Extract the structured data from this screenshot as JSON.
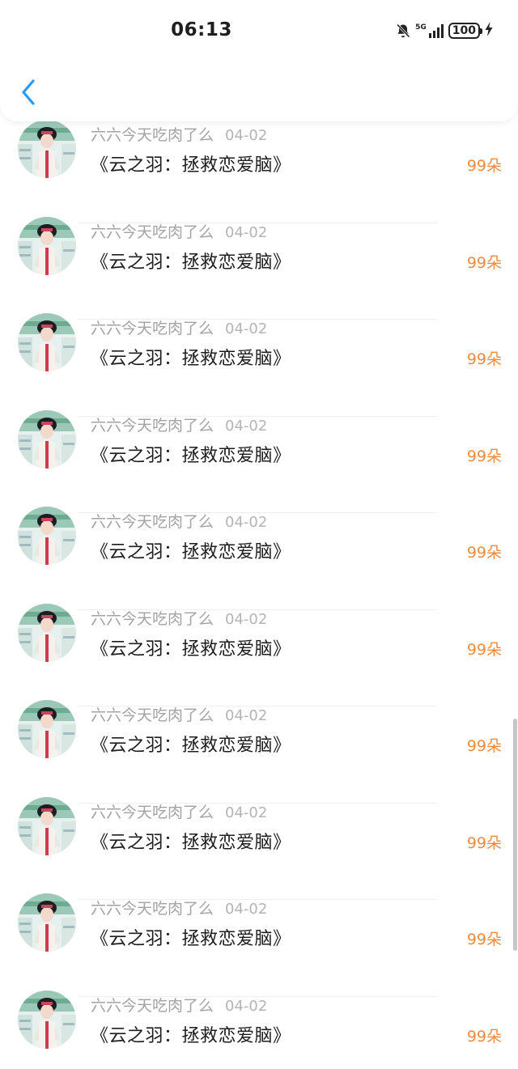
{
  "status_bar": {
    "time": "06:13",
    "network": "5G",
    "battery": "100"
  },
  "header": {
    "back_icon": "chevron-left-icon"
  },
  "colors": {
    "accent": "#2b9af3",
    "count": "#f08a3c",
    "meta": "#a3a3a3"
  },
  "list": {
    "items": [
      {
        "user": "六六今天吃肉了么",
        "date": "04-02",
        "title": "《云之羽：拯救恋爱脑》",
        "count": "99朵"
      },
      {
        "user": "六六今天吃肉了么",
        "date": "04-02",
        "title": "《云之羽：拯救恋爱脑》",
        "count": "99朵"
      },
      {
        "user": "六六今天吃肉了么",
        "date": "04-02",
        "title": "《云之羽：拯救恋爱脑》",
        "count": "99朵"
      },
      {
        "user": "六六今天吃肉了么",
        "date": "04-02",
        "title": "《云之羽：拯救恋爱脑》",
        "count": "99朵"
      },
      {
        "user": "六六今天吃肉了么",
        "date": "04-02",
        "title": "《云之羽：拯救恋爱脑》",
        "count": "99朵"
      },
      {
        "user": "六六今天吃肉了么",
        "date": "04-02",
        "title": "《云之羽：拯救恋爱脑》",
        "count": "99朵"
      },
      {
        "user": "六六今天吃肉了么",
        "date": "04-02",
        "title": "《云之羽：拯救恋爱脑》",
        "count": "99朵"
      },
      {
        "user": "六六今天吃肉了么",
        "date": "04-02",
        "title": "《云之羽：拯救恋爱脑》",
        "count": "99朵"
      },
      {
        "user": "六六今天吃肉了么",
        "date": "04-02",
        "title": "《云之羽：拯救恋爱脑》",
        "count": "99朵"
      },
      {
        "user": "六六今天吃肉了么",
        "date": "04-02",
        "title": "《云之羽：拯救恋爱脑》",
        "count": "99朵"
      }
    ]
  }
}
